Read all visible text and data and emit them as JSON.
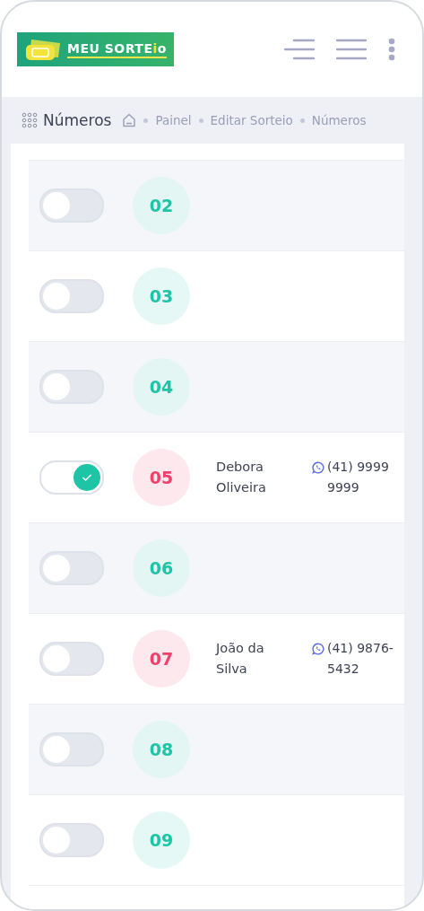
{
  "header": {
    "logo": {
      "parts": [
        {
          "text": "MEU SORTE",
          "accent": false
        },
        {
          "text": "i",
          "accent": true
        },
        {
          "text": "o",
          "accent": false
        }
      ]
    }
  },
  "breadcrumb": {
    "title": "Números",
    "items": [
      "Painel",
      "Editar Sorteio",
      "Números"
    ]
  },
  "rows": [
    {
      "number": "02",
      "checked": false,
      "reserved": false
    },
    {
      "number": "03",
      "checked": false,
      "reserved": false
    },
    {
      "number": "04",
      "checked": false,
      "reserved": false
    },
    {
      "number": "05",
      "checked": true,
      "reserved": true,
      "name": "Debora Oliveira",
      "phone": "(41) 9999 9999"
    },
    {
      "number": "06",
      "checked": false,
      "reserved": false
    },
    {
      "number": "07",
      "checked": false,
      "reserved": true,
      "name": "João da Silva",
      "phone": "(41) 9876-5432"
    },
    {
      "number": "08",
      "checked": false,
      "reserved": false
    },
    {
      "number": "09",
      "checked": false,
      "reserved": false
    }
  ]
}
